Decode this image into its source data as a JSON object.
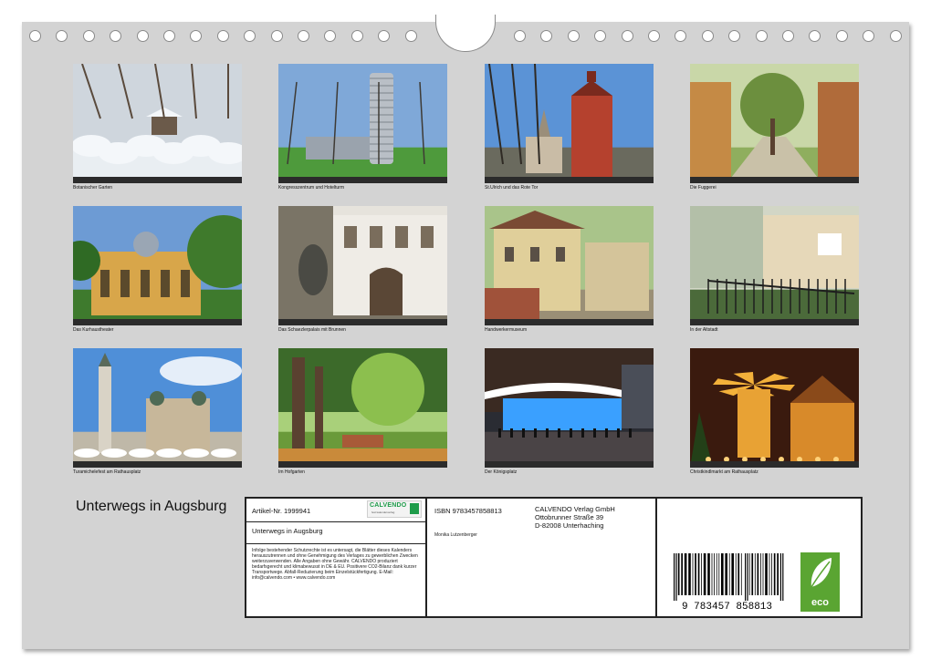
{
  "calendar": {
    "title": "Unterwegs in Augsburg",
    "hole_count_left": 15,
    "hole_count_right": 15
  },
  "photos": [
    {
      "caption": "Botanischer Garten",
      "scene": "snow-garden",
      "colors": {
        "sky": "#cfd6dd",
        "ground": "#e9eef2",
        "accent": "#6b5a4a"
      }
    },
    {
      "caption": "Kongresszentrum und Hotelturm",
      "scene": "tower",
      "colors": {
        "sky": "#7fa8d8",
        "ground": "#4e9a3c",
        "accent": "#b9bfc6"
      }
    },
    {
      "caption": "St.Ulrich und das Rote Tor",
      "scene": "red-gate",
      "colors": {
        "sky": "#5b93d6",
        "ground": "#6a6a5e",
        "accent": "#b5412e"
      }
    },
    {
      "caption": "Die Fuggerei",
      "scene": "lane",
      "colors": {
        "sky": "#c9d7a8",
        "ground": "#8fae5e",
        "accent": "#c58a45"
      }
    },
    {
      "caption": "Das Kurhaustheater",
      "scene": "theatre",
      "colors": {
        "sky": "#6d9bd4",
        "ground": "#3e7a2d",
        "accent": "#d8a64a"
      }
    },
    {
      "caption": "Das Schaezlerpalais mit Brunnen",
      "scene": "palace",
      "colors": {
        "sky": "#e6e3dc",
        "ground": "#7a7466",
        "accent": "#5a4736"
      }
    },
    {
      "caption": "Handwerkermuseum",
      "scene": "old-houses",
      "colors": {
        "sky": "#a9c48a",
        "ground": "#9a8f76",
        "accent": "#e0cf9a"
      }
    },
    {
      "caption": "In der Altstadt",
      "scene": "canal",
      "colors": {
        "sky": "#d2d6c6",
        "ground": "#4b6a3a",
        "accent": "#e6d8b9"
      }
    },
    {
      "caption": "Turamichelefest am Rathausplatz",
      "scene": "town-hall",
      "colors": {
        "sky": "#4f8fd8",
        "ground": "#bfb8a8",
        "accent": "#c7b79a"
      }
    },
    {
      "caption": "Im Hofgarten",
      "scene": "park",
      "colors": {
        "sky": "#a9d07a",
        "ground": "#6a9a3a",
        "accent": "#5a4130"
      }
    },
    {
      "caption": "Der Königsplatz",
      "scene": "night-station",
      "colors": {
        "sky": "#2a2c33",
        "ground": "#4a4446",
        "accent": "#3aa0ff"
      }
    },
    {
      "caption": "Christkindlmarkt am Rathausplatz",
      "scene": "pyramid",
      "colors": {
        "sky": "#3a1a0e",
        "ground": "#6b2c10",
        "accent": "#f3b13a"
      }
    }
  ],
  "info": {
    "artikel": "Artikel-Nr. 1999941",
    "brand": "CALVENDO",
    "brand_sub": "fest kalenderverlag",
    "product_title": "Unterwegs in Augsburg",
    "legal": "Infolge bestehender Schutzrechte ist es untersagt, die Blätter dieses Kalenders herauszutrennen und ohne Genehmigung des Verlages zu gewerblichen Zwecken weiterzuverwenden. Alle Angaben ohne Gewähr. CALVENDO produziert bedarfsgerecht und klimabewusst in DE & EU. Positivere CO2-Bilanz dank kurzer Transportwege. Abfall-Reduzierung beim Einzelstückfertigung. E-Mail: info@calvendo.com • www.calvendo.com",
    "isbn": "ISBN 9783457858813",
    "author": "Monika Lutzenberger",
    "publisher_lines": [
      "CALVENDO Verlag GmbH",
      "Ottobrunner Straße 39",
      "D-82008 Unterhaching"
    ],
    "barcode_digits": "9 783457 858813",
    "eco_label": "eco"
  }
}
